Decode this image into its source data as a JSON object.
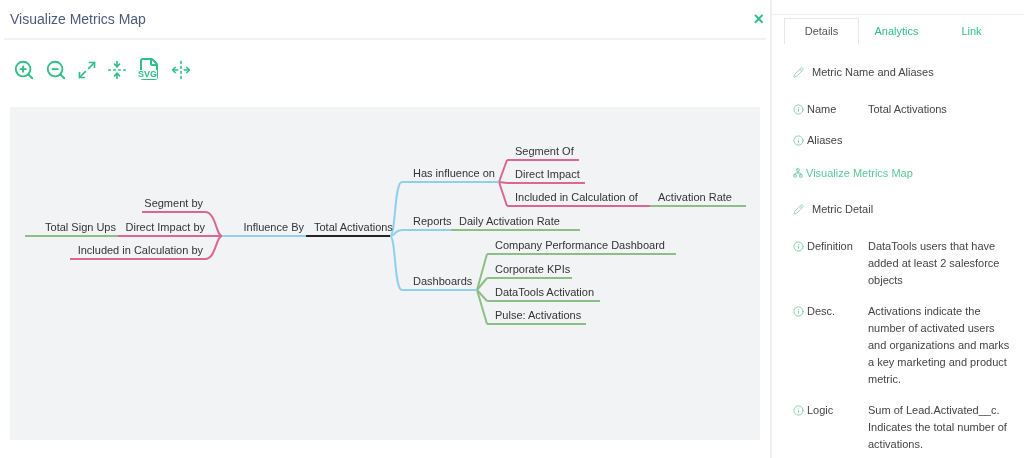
{
  "dialog": {
    "title": "Visualize Metrics Map",
    "close": "×"
  },
  "toolbar": {
    "export_label": "SVG"
  },
  "map": {
    "root": {
      "label": "Total Activations",
      "kind": "root"
    },
    "upstream": {
      "label": "Influence By",
      "kind": "category",
      "children": [
        {
          "label": "Segment by",
          "kind": "relation"
        },
        {
          "label": "Direct Impact by",
          "kind": "relation",
          "children": [
            {
              "label": "Total Sign Ups",
              "kind": "metric"
            }
          ]
        },
        {
          "label": "Included in Calculation by",
          "kind": "relation"
        }
      ]
    },
    "downstream": [
      {
        "label": "Has influence on",
        "kind": "category",
        "children": [
          {
            "label": "Segment Of",
            "kind": "relation"
          },
          {
            "label": "Direct Impact",
            "kind": "relation"
          },
          {
            "label": "Included in Calculation of",
            "kind": "relation",
            "children": [
              {
                "label": "Activation Rate",
                "kind": "metric"
              }
            ]
          }
        ]
      },
      {
        "label": "Reports",
        "kind": "category",
        "children": [
          {
            "label": "Daily Activation Rate",
            "kind": "metric"
          }
        ]
      },
      {
        "label": "Dashboards",
        "kind": "category",
        "children": [
          {
            "label": "Company Performance Dashboard",
            "kind": "metric"
          },
          {
            "label": "Corporate KPIs",
            "kind": "metric"
          },
          {
            "label": "DataTools Activation",
            "kind": "metric"
          },
          {
            "label": "Pulse: Activations",
            "kind": "metric"
          }
        ]
      }
    ]
  },
  "tabs": [
    {
      "label": "Details",
      "selected": true
    },
    {
      "label": "Analytics",
      "selected": false
    },
    {
      "label": "Link",
      "selected": false
    }
  ],
  "details": [
    {
      "kind": "section",
      "label": "Metric Name and Aliases"
    },
    {
      "kind": "field",
      "label": "Name",
      "value": "Total Activations"
    },
    {
      "kind": "field",
      "label": "Aliases"
    },
    {
      "kind": "link",
      "label": "Visualize Metrics Map"
    },
    {
      "kind": "section",
      "label": "Metric Detail"
    },
    {
      "kind": "field",
      "label": "Definition",
      "value": "DataTools users that have added at least 2 salesforce objects"
    },
    {
      "kind": "field",
      "label": "Desc.",
      "value": "Activations indicate the number of activated users and organizations and marks a key marketing and product metric."
    },
    {
      "kind": "field",
      "label": "Logic",
      "value": "Sum of Lead.Activated__c. Indicates the total number of activations."
    }
  ]
}
